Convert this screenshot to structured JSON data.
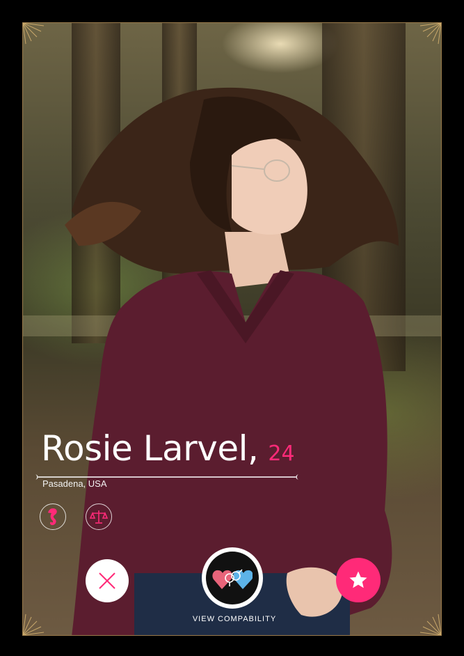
{
  "profile": {
    "name": "Rosie Larvel,",
    "age": "24",
    "location": "Pasadena, USA"
  },
  "badges": [
    {
      "icon": "seahorse-icon"
    },
    {
      "icon": "libra-scales-icon"
    }
  ],
  "actions": {
    "compat_label": "VIEW COMPABILITY"
  },
  "colors": {
    "accent": "#ff2a78",
    "frame": "#000000",
    "border": "#9a7a4a"
  }
}
